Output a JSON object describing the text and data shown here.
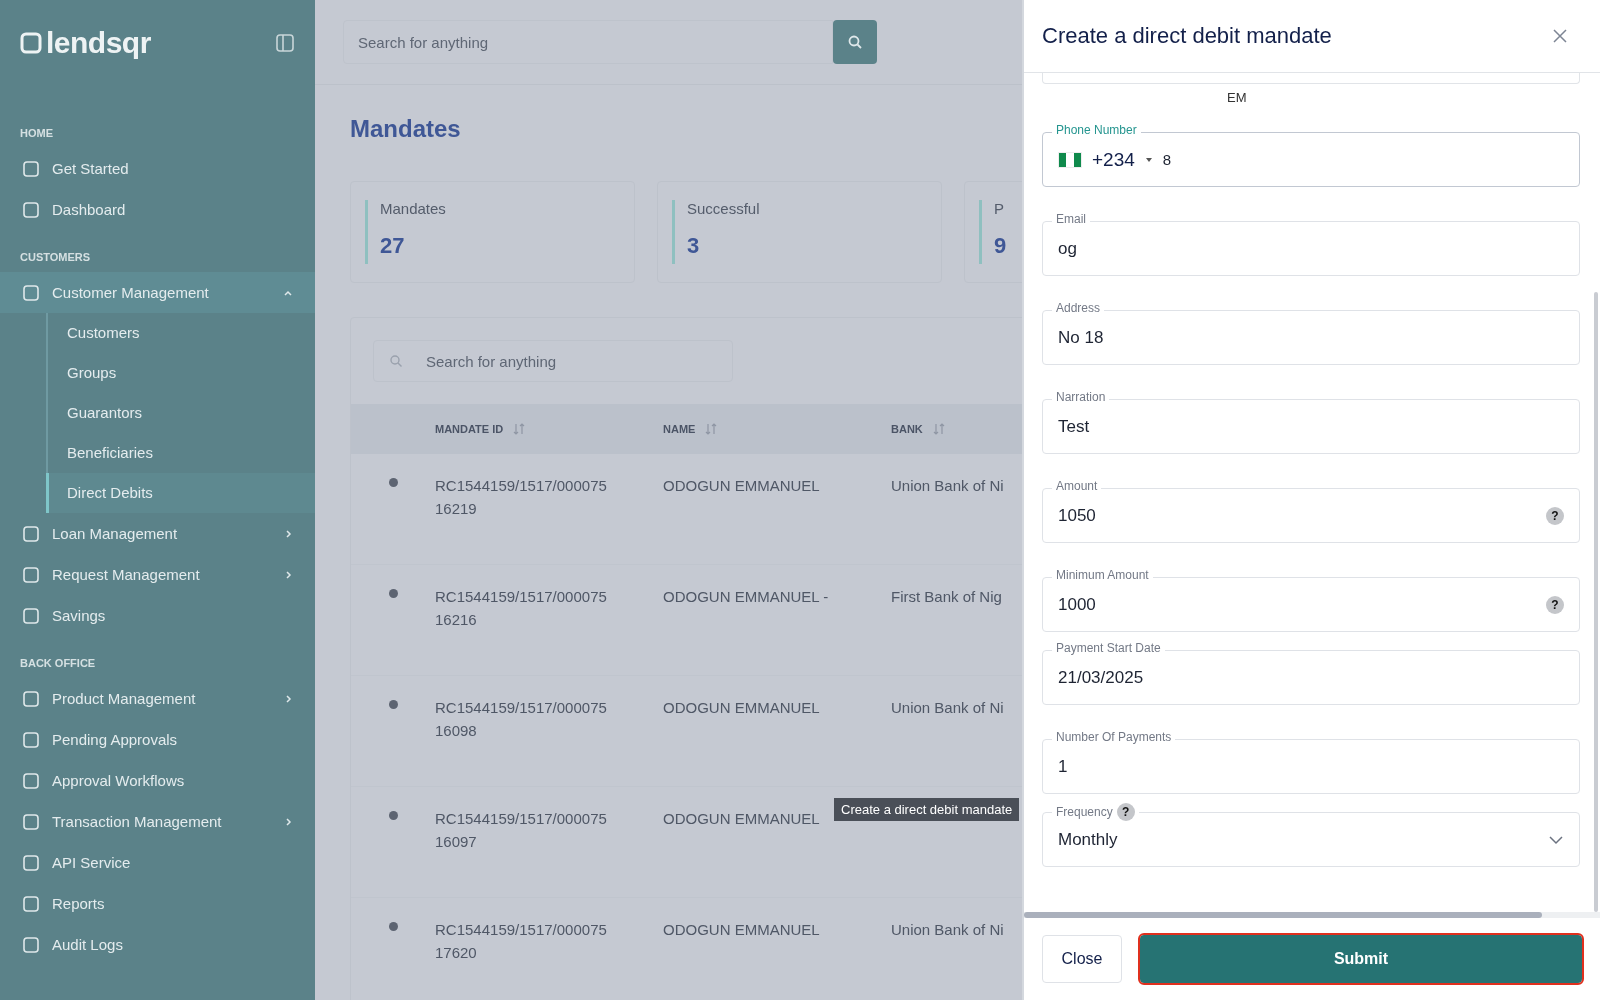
{
  "sidebar": {
    "logo": "lendsqr",
    "sections": [
      {
        "title": "HOME",
        "items": [
          {
            "label": "Get Started",
            "kind": "link",
            "selected": false
          },
          {
            "label": "Dashboard",
            "kind": "link",
            "selected": false
          }
        ]
      },
      {
        "title": "CUSTOMERS",
        "items": [
          {
            "label": "Customer Management",
            "kind": "group",
            "selected": false,
            "expanded": true,
            "children": [
              {
                "label": "Customers",
                "selected": false
              },
              {
                "label": "Groups",
                "selected": false
              },
              {
                "label": "Guarantors",
                "selected": false
              },
              {
                "label": "Beneficiaries",
                "selected": false
              },
              {
                "label": "Direct Debits",
                "selected": true
              }
            ]
          },
          {
            "label": "Loan Management",
            "kind": "group",
            "selected": false,
            "expanded": false
          },
          {
            "label": "Request Management",
            "kind": "group",
            "selected": false,
            "expanded": false
          },
          {
            "label": "Savings",
            "kind": "link",
            "selected": false
          }
        ]
      },
      {
        "title": "BACK OFFICE",
        "items": [
          {
            "label": "Product Management",
            "kind": "group",
            "selected": false,
            "expanded": false
          },
          {
            "label": "Pending Approvals",
            "kind": "link",
            "selected": false
          },
          {
            "label": "Approval Workflows",
            "kind": "link",
            "selected": false
          },
          {
            "label": "Transaction Management",
            "kind": "group",
            "selected": false,
            "expanded": false
          },
          {
            "label": "API Service",
            "kind": "link",
            "selected": false
          },
          {
            "label": "Reports",
            "kind": "link",
            "selected": false
          },
          {
            "label": "Audit Logs",
            "kind": "link",
            "selected": false
          }
        ]
      }
    ]
  },
  "topbar": {
    "search": {
      "placeholder": "Search for anything"
    }
  },
  "page_title": "Mandates",
  "stats": [
    {
      "label": "Mandates",
      "value": "27"
    },
    {
      "label": "Successful",
      "value": "3"
    },
    {
      "label": "P",
      "value": "9"
    }
  ],
  "table": {
    "search": {
      "placeholder": "Search for anything"
    },
    "columns": [
      "MANDATE ID",
      "NAME",
      "BANK"
    ],
    "rows": [
      {
        "id": [
          "RC1544159/1517/000075",
          "16219"
        ],
        "name": "ODOGUN EMMANUEL",
        "bank": "Union Bank of Ni"
      },
      {
        "id": [
          "RC1544159/1517/000075",
          "16216"
        ],
        "name": "ODOGUN EMMANUEL -",
        "bank": "First Bank of Nig"
      },
      {
        "id": [
          "RC1544159/1517/000075",
          "16098"
        ],
        "name": "ODOGUN EMMANUEL",
        "bank": "Union Bank of Ni"
      },
      {
        "id": [
          "RC1544159/1517/000075",
          "16097"
        ],
        "name": "ODOGUN EMMANUEL"
      },
      {
        "id": [
          "RC1544159/1517/000075",
          "17620"
        ],
        "name": "ODOGUN EMMANUEL",
        "bank": "Union Bank of Ni"
      }
    ]
  },
  "tooltip": "Create a direct debit mandate",
  "drawer": {
    "title": "Create a direct debit mandate",
    "partial_text": "EM",
    "fields": [
      {
        "kind": "phone",
        "label": "Phone Number",
        "code": "+234",
        "value": "8",
        "focused": true
      },
      {
        "kind": "text",
        "label": "Email",
        "value": "og",
        "focused": false
      },
      {
        "kind": "text",
        "label": "Address",
        "value": "No 18",
        "focused": false
      },
      {
        "kind": "text",
        "label": "Narration",
        "value": "Test",
        "focused": false
      },
      {
        "kind": "text",
        "label": "Amount",
        "value": "1050",
        "focused": false,
        "help": "?"
      },
      {
        "kind": "text",
        "label": "Minimum Amount",
        "value": "1000",
        "focused": false,
        "help": "?"
      },
      {
        "kind": "text",
        "label": "Payment Start Date",
        "value": "21/03/2025",
        "focused": false
      },
      {
        "kind": "text",
        "label": "Number Of Payments",
        "value": "1",
        "focused": false
      },
      {
        "kind": "select",
        "label": "Frequency",
        "value": "Monthly",
        "focused": false,
        "help": "?"
      }
    ],
    "buttons": [
      {
        "label": "Close",
        "kind": "secondary",
        "focused": false
      },
      {
        "label": "Submit",
        "kind": "primary",
        "focused": true
      }
    ]
  }
}
